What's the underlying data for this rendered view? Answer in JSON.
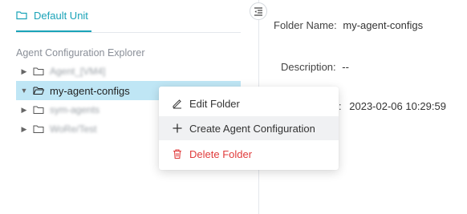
{
  "unit_tab": {
    "label": "Default Unit",
    "icon": "folder-icon",
    "accent": "#1aa3b8"
  },
  "explorer": {
    "title": "Agent Configuration Explorer",
    "nodes": [
      {
        "label": "Agent_[VM4]",
        "expanded": false,
        "selected": false,
        "redacted": true
      },
      {
        "label": "my-agent-configs",
        "expanded": true,
        "selected": true,
        "redacted": false
      },
      {
        "label": "sym-agents",
        "expanded": false,
        "selected": false,
        "redacted": true
      },
      {
        "label": "WoRe/Test",
        "expanded": false,
        "selected": false,
        "redacted": true
      }
    ]
  },
  "details": {
    "folder_name_label": "Folder Name:",
    "folder_name_value": "my-agent-configs",
    "description_label": "Description:",
    "description_value": "--",
    "created_label": ":",
    "created_value": "2023-02-06 10:29:59"
  },
  "context_menu": {
    "items": [
      {
        "label": "Edit Folder",
        "icon": "edit-icon"
      },
      {
        "label": "Create Agent Configuration",
        "icon": "plus-icon"
      },
      {
        "label": "Delete Folder",
        "icon": "trash-icon",
        "color": "#e03b3b"
      }
    ]
  },
  "colors": {
    "selection": "#bfe6f5",
    "danger": "#e03b3b",
    "accent": "#1aa3b8"
  }
}
